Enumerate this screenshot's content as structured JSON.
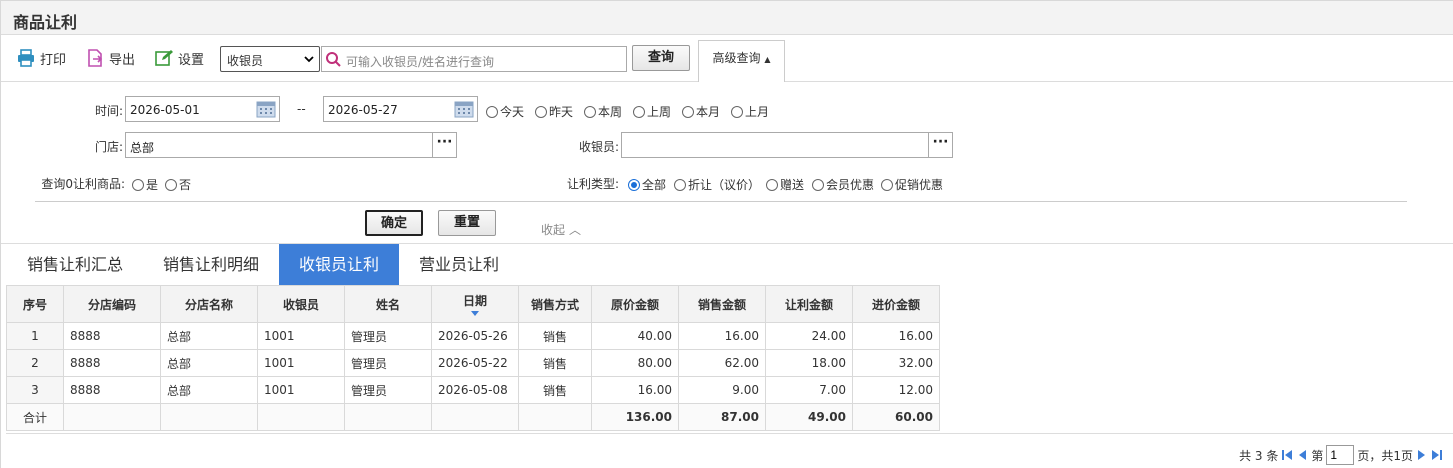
{
  "title": "商品让利",
  "toolbar": {
    "print": "打印",
    "export": "导出",
    "settings": "设置",
    "select_value": "收银员",
    "search_placeholder": "可输入收银员/姓名进行查询",
    "query": "查询",
    "advanced": "高级查询"
  },
  "filters": {
    "time_label": "时间:",
    "date_from": "2026-05-01",
    "date_sep": "--",
    "date_to": "2026-05-27",
    "quick": [
      "今天",
      "昨天",
      "本周",
      "上周",
      "本月",
      "上月"
    ],
    "store_label": "门店:",
    "store_value": "总部",
    "cashier_label": "收银员:",
    "cashier_value": "",
    "zero_label": "查询0让利商品:",
    "zero_options": [
      "是",
      "否"
    ],
    "type_label": "让利类型:",
    "type_options": [
      "全部",
      "折让（议价）",
      "赠送",
      "会员优惠",
      "促销优惠"
    ],
    "type_selected": "全部",
    "confirm": "确定",
    "reset": "重置",
    "collapse": "收起"
  },
  "tabs": [
    "销售让利汇总",
    "销售让利明细",
    "收银员让利",
    "营业员让利"
  ],
  "active_tab": "收银员让利",
  "table": {
    "headers": [
      "序号",
      "分店编码",
      "分店名称",
      "收银员",
      "姓名",
      "日期",
      "销售方式",
      "原价金额",
      "销售金额",
      "让利金额",
      "进价金额"
    ],
    "rows": [
      [
        "1",
        "8888",
        "总部",
        "1001",
        "管理员",
        "2026-05-26",
        "销售",
        "40.00",
        "16.00",
        "24.00",
        "16.00"
      ],
      [
        "2",
        "8888",
        "总部",
        "1001",
        "管理员",
        "2026-05-22",
        "销售",
        "80.00",
        "62.00",
        "18.00",
        "32.00"
      ],
      [
        "3",
        "8888",
        "总部",
        "1001",
        "管理员",
        "2026-05-08",
        "销售",
        "16.00",
        "9.00",
        "7.00",
        "12.00"
      ]
    ],
    "total": [
      "合计",
      "",
      "",
      "",
      "",
      "",
      "",
      "136.00",
      "87.00",
      "49.00",
      "60.00"
    ]
  },
  "pager": {
    "total_text": "共 3 条",
    "page_prefix": "第",
    "page_value": "1",
    "page_suffix": "页，共1页"
  },
  "colors": {
    "accent": "#3d7ed8",
    "radio": "#1a6fd8"
  }
}
